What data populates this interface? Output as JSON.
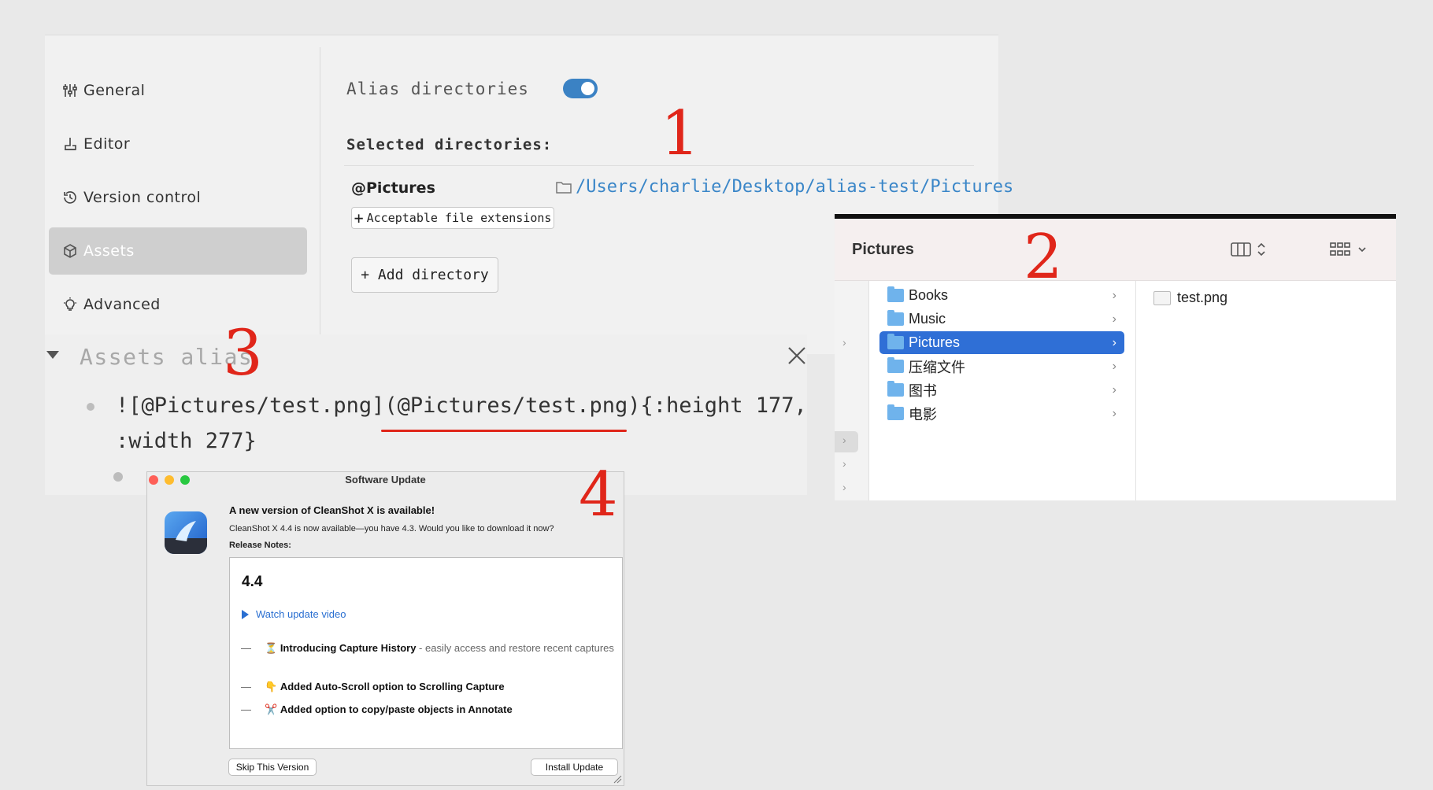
{
  "settings": {
    "nav": [
      {
        "label": "General",
        "icon": "sliders-icon"
      },
      {
        "label": "Editor",
        "icon": "pen-icon"
      },
      {
        "label": "Version control",
        "icon": "history-icon"
      },
      {
        "label": "Assets",
        "icon": "cube-icon",
        "active": true
      },
      {
        "label": "Advanced",
        "icon": "bulb-icon"
      }
    ],
    "alias_directories_label": "Alias directories",
    "alias_directories_enabled": true,
    "selected_directories_label": "Selected directories:",
    "directory": {
      "name": "@Pictures",
      "path": "/Users/charlie/Desktop/alias-test/Pictures"
    },
    "extensions_button": "Acceptable file extensions",
    "add_directory_button": "+ Add directory"
  },
  "annotations": {
    "n1": "1",
    "n2": "2",
    "n3": "3",
    "n4": "4",
    "color": "#e0261a"
  },
  "alias_block": {
    "title": "Assets alias",
    "line1": "![@Pictures/test.png](@Pictures/test.png){:height 177,",
    "line2": ":width 277}"
  },
  "finder": {
    "title": "Pictures",
    "folders": [
      {
        "label": "Books"
      },
      {
        "label": "Music"
      },
      {
        "label": "Pictures",
        "selected": true
      },
      {
        "label": "压缩文件"
      },
      {
        "label": "图书"
      },
      {
        "label": "电影"
      }
    ],
    "file": "test.png"
  },
  "update": {
    "window_title": "Software Update",
    "headline": "A new version of CleanShot X is available!",
    "subtitle": "CleanShot X 4.4 is now available—you have 4.3. Would you like to download it now?",
    "notes_label": "Release Notes:",
    "version": "4.4",
    "watch_link": "Watch update video",
    "items": [
      {
        "emoji": "⏳",
        "bold": "Introducing Capture History",
        "rest": " - easily access and restore recent captures"
      },
      {
        "emoji": "👇",
        "bold": "Added Auto-Scroll option to Scrolling Capture",
        "rest": ""
      },
      {
        "emoji": "✂️",
        "bold": "Added option to copy/paste objects in Annotate",
        "rest": ""
      }
    ],
    "skip_button": "Skip This Version",
    "install_button": "Install Update"
  }
}
